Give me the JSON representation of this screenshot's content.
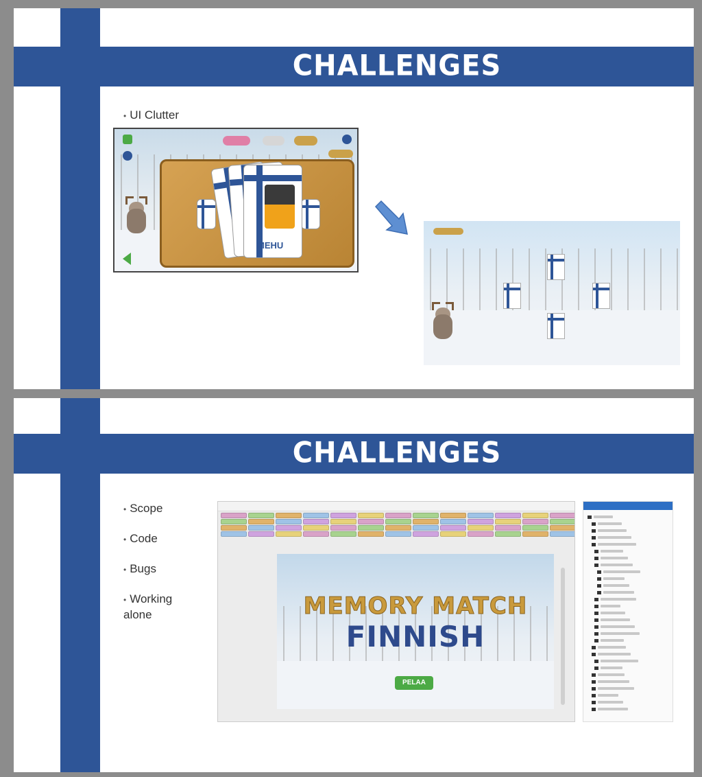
{
  "slides": [
    {
      "title": "CHALLENGES",
      "bullets": [
        "UI Clutter"
      ],
      "game_screenshot": {
        "card_label": "MEHU"
      }
    },
    {
      "title": "CHALLENGES",
      "bullets": [
        "Scope",
        "Code",
        "Bugs",
        "Working alone"
      ],
      "editor_screenshot": {
        "game_title_line1": "MEMORY MATCH",
        "game_title_line2": "FINNISH",
        "play_button": "PELAA"
      }
    }
  ],
  "colors": {
    "finnish_blue": "#2e5597",
    "frame_grey": "#8c8c8c"
  }
}
